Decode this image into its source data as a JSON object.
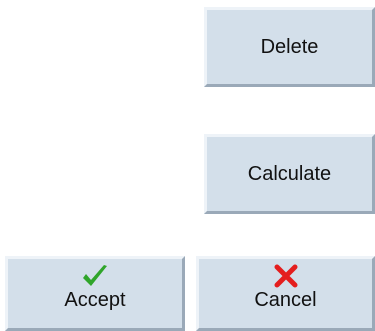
{
  "softkeys": {
    "delete": {
      "label": "Delete"
    },
    "calculate": {
      "label": "Calculate"
    },
    "accept": {
      "label": "Accept",
      "icon": "checkmark-icon",
      "icon_color": "#2fa52a"
    },
    "cancel": {
      "label": "Cancel",
      "icon": "cross-icon",
      "icon_color": "#e41e1e"
    }
  }
}
